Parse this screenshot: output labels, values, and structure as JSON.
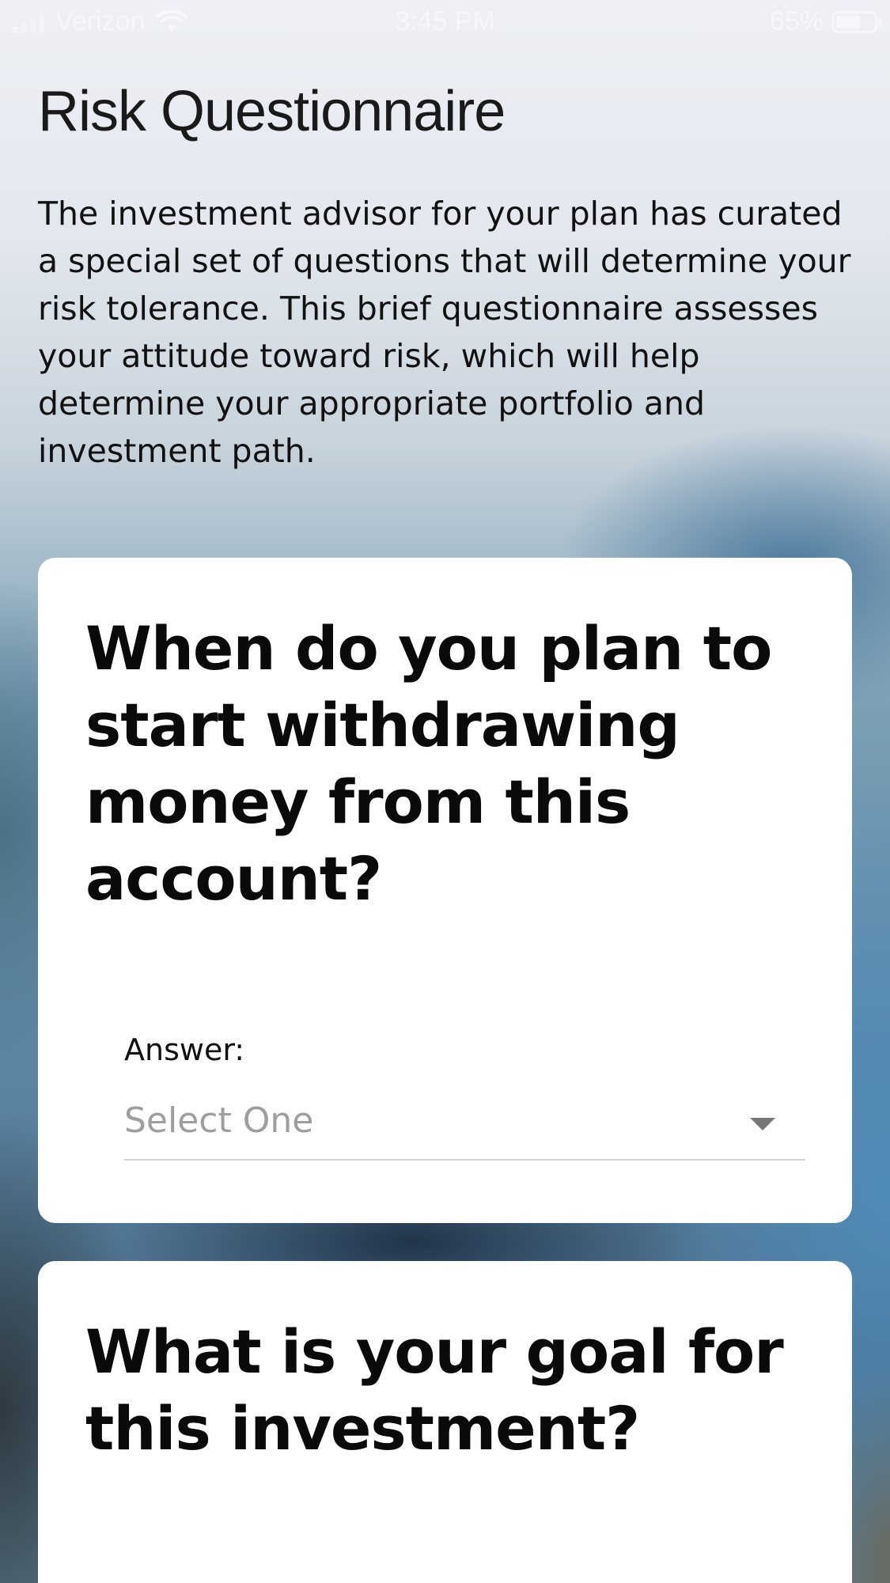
{
  "status_bar": {
    "carrier": "Verizon",
    "time": "3:45 PM",
    "battery_percent_label": "65%",
    "battery_level": 0.65
  },
  "header": {
    "title": "Risk Questionnaire",
    "description": "The investment advisor for your plan has curated a special set of questions that will determine your risk tolerance. This brief questionnaire assesses your attitude toward risk, which will help determine your appropriate portfolio and investment path."
  },
  "questions": [
    {
      "text": "When do you plan to start withdrawing money from this account?",
      "answer_label": "Answer:",
      "placeholder": "Select One"
    },
    {
      "text": "What is your goal for this investment?"
    }
  ],
  "colors": {
    "card_background": "#ffffff",
    "placeholder_text": "#9e9e9e",
    "primary_text": "#0a0a0a"
  }
}
